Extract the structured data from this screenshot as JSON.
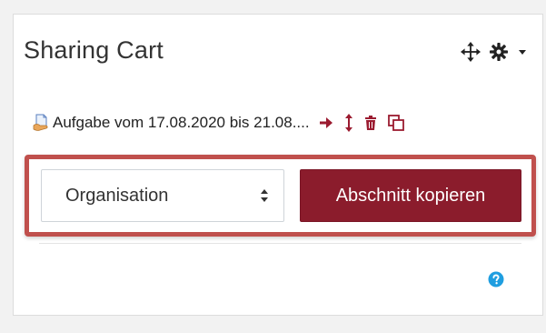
{
  "block": {
    "title": "Sharing Cart"
  },
  "header_controls": {
    "move_icon": "move-icon",
    "actions_icon": "gear-icon",
    "menu_icon": "caret-down-icon"
  },
  "item": {
    "label": "Aufgabe vom 17.08.2020 bis 21.08....",
    "icon": "assignment-icon",
    "actions": [
      "arrow-right-icon",
      "move-vertical-icon",
      "trash-icon",
      "copy-icon"
    ]
  },
  "section_form": {
    "selected_section": "Organisation",
    "copy_button_label": "Abschnitt kopieren"
  },
  "colors": {
    "accent": "#8b1c2c",
    "highlight_border": "#c0504d",
    "help": "#1f9ee0"
  },
  "help": {
    "icon": "question-circle-icon"
  }
}
